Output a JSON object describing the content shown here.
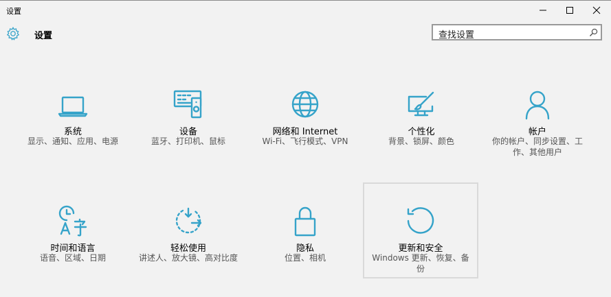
{
  "window": {
    "title": "设置"
  },
  "header": {
    "title": "设置"
  },
  "search": {
    "placeholder": "查找设置"
  },
  "colors": {
    "accent": "#35a3c9",
    "background": "#f2f2f2"
  },
  "tiles": [
    {
      "name": "系统",
      "desc": "显示、通知、应用、电源",
      "icon": "laptop-icon"
    },
    {
      "name": "设备",
      "desc": "蓝牙、打印机、鼠标",
      "icon": "devices-icon"
    },
    {
      "name": "网络和 Internet",
      "desc": "Wi-Fi、飞行模式、VPN",
      "icon": "globe-icon"
    },
    {
      "name": "个性化",
      "desc": "背景、锁屏、颜色",
      "icon": "paint-icon"
    },
    {
      "name": "帐户",
      "desc": "你的帐户、同步设置、工作、其他用户",
      "icon": "person-icon"
    },
    {
      "name": "时间和语言",
      "desc": "语音、区域、日期",
      "icon": "time-language-icon"
    },
    {
      "name": "轻松使用",
      "desc": "讲述人、放大镜、高对比度",
      "icon": "ease-of-access-icon"
    },
    {
      "name": "隐私",
      "desc": "位置、相机",
      "icon": "lock-icon"
    },
    {
      "name": "更新和安全",
      "desc": "Windows 更新、恢复、备份",
      "icon": "update-icon"
    }
  ]
}
